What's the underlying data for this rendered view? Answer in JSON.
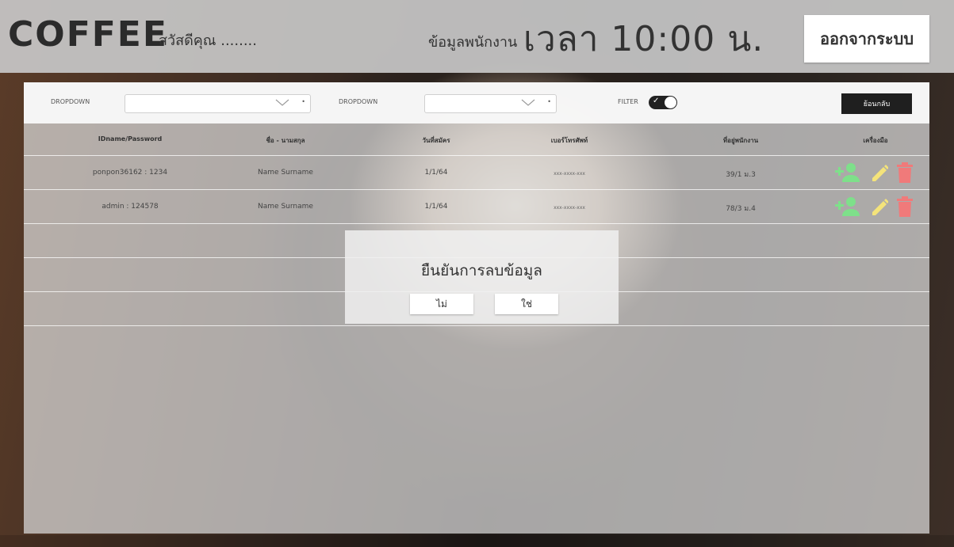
{
  "header": {
    "logo": "COFFEE",
    "greeting": "สวัสดีคุณ ........",
    "staff_info_label": "ข้อมูลพนักงาน",
    "clock": "เวลา 10:00 น.",
    "logout_label": "ออกจากระบบ"
  },
  "filter_bar": {
    "dropdown1_label": "DROPDOWN",
    "dropdown2_label": "DROPDOWN",
    "filter_label": "FILTER",
    "filter_on": true,
    "back_label": "ย้อนกลับ"
  },
  "table": {
    "columns": [
      "IDname/Password",
      "ชื่อ - นามสกุล",
      "วันที่สมัคร",
      "เบอร์โทรศัพท์",
      "ที่อยู่พนักงาน",
      "เครื่องมือ"
    ],
    "rows": [
      {
        "cred": "ponpon36162 : 1234",
        "name": "Name   Surname",
        "date": "1/1/64",
        "phone": "xxx-xxxx-xxx",
        "address": "39/1 ม.3"
      },
      {
        "cred": "admin : 124578",
        "name": "Name   Surname",
        "date": "1/1/64",
        "phone": "xxx-xxxx-xxx",
        "address": "78/3 ม.4"
      }
    ]
  },
  "modal": {
    "title": "ยืนยันการลบข้อมูล",
    "no_label": "ไม่",
    "yes_label": "ใช่"
  },
  "icons": {
    "add": "add-user-icon",
    "edit": "pencil-icon",
    "delete": "trash-icon"
  },
  "colors": {
    "add": "#7ee08a",
    "edit": "#f4e37a",
    "delete": "#f07a7a"
  }
}
